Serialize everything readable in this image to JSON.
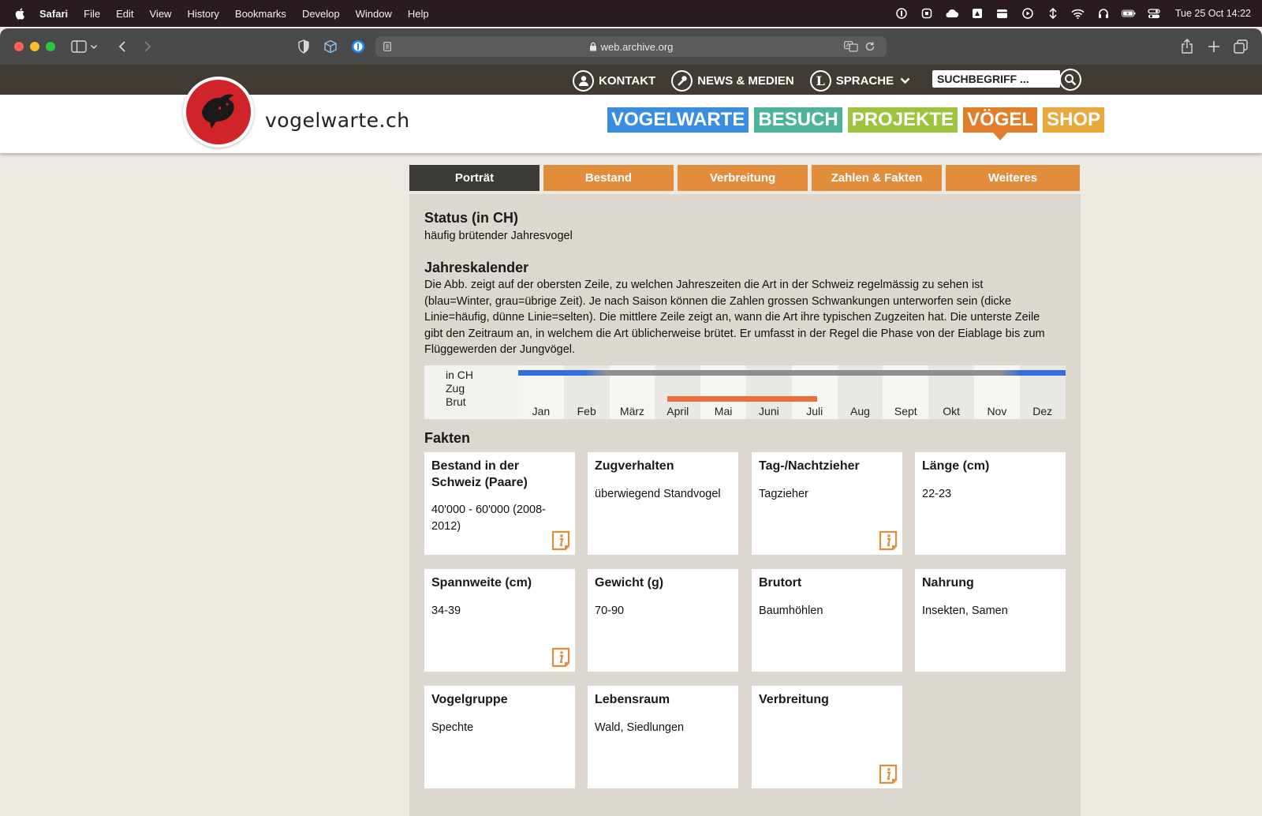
{
  "menubar": {
    "app_name": "Safari",
    "items": [
      "File",
      "Edit",
      "View",
      "History",
      "Bookmarks",
      "Develop",
      "Window",
      "Help"
    ],
    "clock": "Tue 25 Oct  14:22"
  },
  "browser": {
    "url": "web.archive.org"
  },
  "site": {
    "name": "vogelwarte.ch",
    "top_nav": {
      "kontakt": "KONTAKT",
      "news": "NEWS & MEDIEN",
      "sprache": "SPRACHE",
      "sprache_icon_letter": "L",
      "search_placeholder": "SUCHBEGRIFF ..."
    },
    "main_nav": [
      {
        "label": "VOGELWARTE",
        "color": "#3b8de0"
      },
      {
        "label": "BESUCH",
        "color": "#4fb39a"
      },
      {
        "label": "PROJEKTE",
        "color": "#9cc43c"
      },
      {
        "label": "VÖGEL",
        "color": "#e07e2a",
        "active": true
      },
      {
        "label": "SHOP",
        "color": "#e8a83a"
      }
    ],
    "accent_colors": {
      "brand_red": "#d0242a",
      "header_dark": "#413b34",
      "tab_orange": "#e28d3c",
      "tab_active": "#3b3a36"
    }
  },
  "tabs": [
    "Porträt",
    "Bestand",
    "Verbreitung",
    "Zahlen & Fakten",
    "Weiteres"
  ],
  "status": {
    "title": "Status (in CH)",
    "text": "häufig brütender Jahresvogel"
  },
  "jahreskalender": {
    "title": "Jahreskalender",
    "lines": [
      "Die Abb. zeigt auf der obersten Zeile, zu welchen Jahreszeiten die Art in der Schweiz regelmässig zu sehen ist",
      "(blau=Winter, grau=übrige Zeit). Je nach Saison können die Zahlen grossen Schwankungen unterworfen sein (dicke",
      "Linie=häufig, dünne Linie=selten). Die mittlere Zeile zeigt an, wann die Art ihre typischen Zugzeiten hat. Die unterste Zeile",
      "gibt den Zeitraum an, in welchem die Art üblicherweise brütet. Er umfasst in der Regel die Phase von der Eiablage bis zum",
      "Flüggewerden der Jungvögel."
    ],
    "row_labels": [
      "in CH",
      "Zug",
      "Brut"
    ],
    "months": [
      "Jan",
      "Feb",
      "März",
      "April",
      "Mai",
      "Juni",
      "Juli",
      "Aug",
      "Sept",
      "Okt",
      "Nov",
      "Dez"
    ],
    "colors": {
      "winter": "#2f6fe0",
      "other": "#8f8f8f",
      "brut": "#e8713a"
    }
  },
  "fakten": {
    "title": "Fakten",
    "cards": [
      {
        "title": "Bestand in der Schweiz (Paare)",
        "value": "40'000 - 60'000 (2008-2012)",
        "info": true
      },
      {
        "title": "Zugverhalten",
        "value": "überwiegend Standvogel",
        "info": false
      },
      {
        "title": "Tag-/Nachtzieher",
        "value": "Tagzieher",
        "info": true
      },
      {
        "title": "Länge (cm)",
        "value": "22-23",
        "info": false
      },
      {
        "title": "Spannweite (cm)",
        "value": "34-39",
        "info": true
      },
      {
        "title": "Gewicht (g)",
        "value": "70-90",
        "info": false
      },
      {
        "title": "Brutort",
        "value": "Baumhöhlen",
        "info": false
      },
      {
        "title": "Nahrung",
        "value": "Insekten, Samen",
        "info": false
      },
      {
        "title": "Vogelgruppe",
        "value": "Spechte",
        "info": false
      },
      {
        "title": "Lebensraum",
        "value": "Wald, Siedlungen",
        "info": false
      },
      {
        "title": "Verbreitung",
        "value": "",
        "info": true
      }
    ]
  }
}
